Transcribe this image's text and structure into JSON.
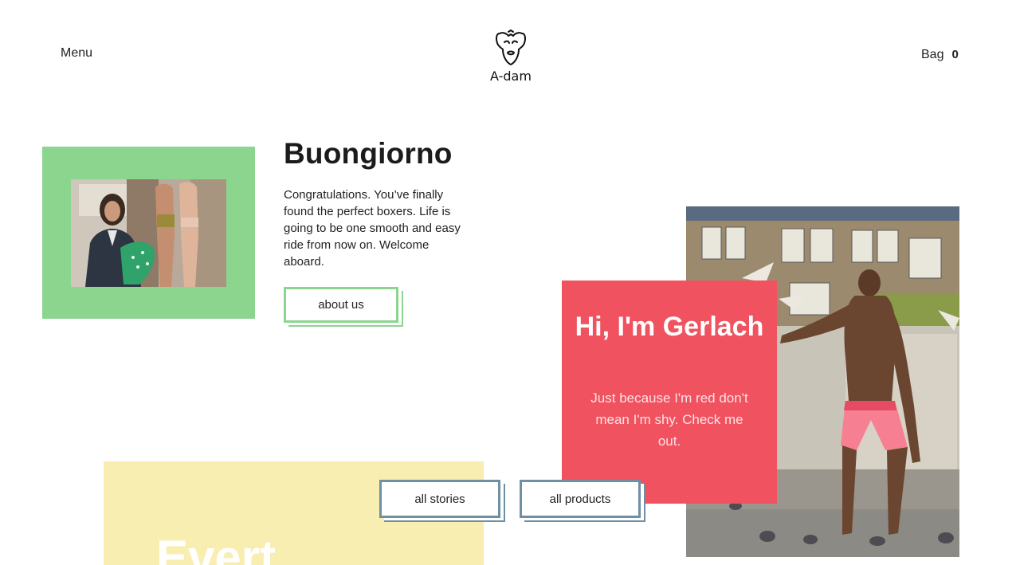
{
  "header": {
    "menu_label": "Menu",
    "logo_text": "A-dam",
    "bag_label": "Bag",
    "bag_count": "0"
  },
  "intro": {
    "title": "Buongiorno",
    "body": "Congratulations. You’ve finally found the perfect boxers. Life is going to be one smooth and easy ride from now on. Welcome aboard.",
    "button_label": "about us"
  },
  "feature": {
    "title": "Hi, I'm Gerlach",
    "body": "Just because I'm red don't mean I'm shy. Check me out."
  },
  "story": {
    "title": "Evert"
  },
  "buttons": {
    "stories_label": "all stories",
    "products_label": "all products"
  },
  "colors": {
    "green": "#8bd58f",
    "red": "#f0525f",
    "yellow": "#f8eeb2",
    "blue_border": "#6f8fa3"
  }
}
